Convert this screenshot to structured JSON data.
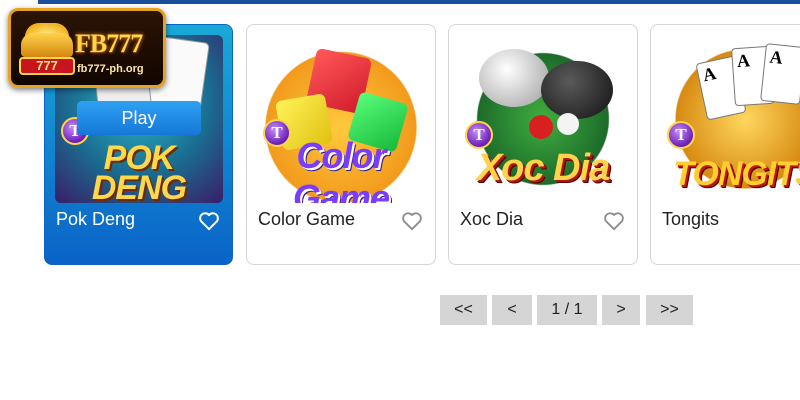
{
  "logo": {
    "badge": "777",
    "brand": "FB777",
    "url": "fb777-ph.org"
  },
  "games": [
    {
      "name": "Pok Deng",
      "art_title": "POK DENG",
      "badge": "T",
      "active": true,
      "play_label": "Play"
    },
    {
      "name": "Color Game",
      "art_title": "Color Game",
      "badge": "T",
      "active": false
    },
    {
      "name": "Xoc Dia",
      "art_title": "Xoc Dia",
      "badge": "T",
      "active": false
    },
    {
      "name": "Tongits",
      "art_title": "TONGITS",
      "badge": "T",
      "active": false
    }
  ],
  "pagination": {
    "first": "<<",
    "prev": "<",
    "current": "1 / 1",
    "next": ">",
    "last": ">>"
  },
  "colors": {
    "accent": "#0a63c8",
    "active_card_top": "#19a9d6",
    "top_rule": "#1a4f9c",
    "pager_bg": "#d5d5d5"
  },
  "icons": {
    "favorite": "heart-outline-icon"
  }
}
